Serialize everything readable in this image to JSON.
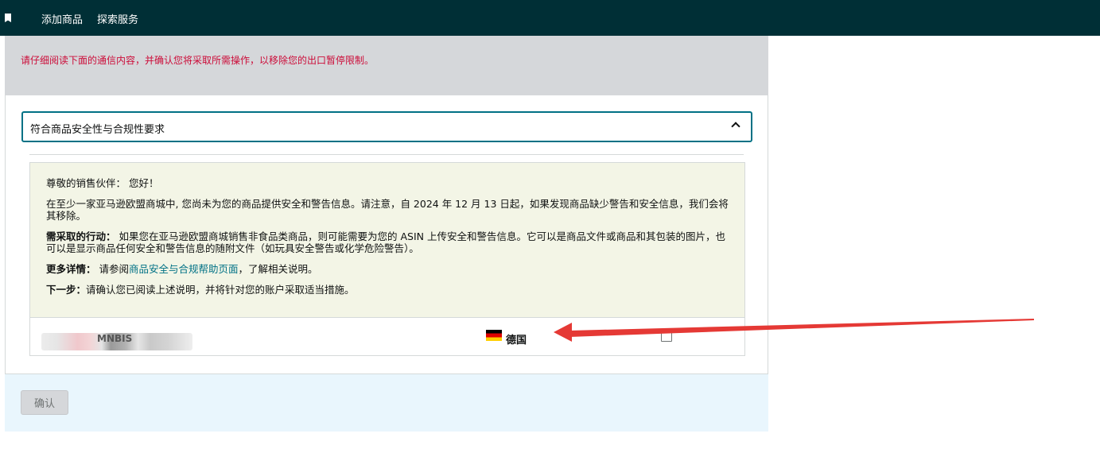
{
  "nav": {
    "add_product": "添加商品",
    "explore_services": "探索服务"
  },
  "notice": {
    "text": "请仔细阅读下面的通信内容，并确认您将采取所需操作，以移除您的出口暂停限制。"
  },
  "accordion": {
    "title": "符合商品安全性与合规性要求"
  },
  "message": {
    "greeting": "尊敬的销售伙伴： 您好！",
    "intro": "在至少一家亚马逊欧盟商城中, 您尚未为您的商品提供安全和警告信息。请注意，自 2024 年 12 月 13 日起，如果发现商品缺少警告和安全信息，我们会将其移除。",
    "action_label": "需采取的行动：",
    "action_text": " 如果您在亚马逊欧盟商城销售非食品类商品，则可能需要为您的 ASIN 上传安全和警告信息。它可以是商品文件或商品和其包装的图片，也可以是显示商品任何安全和警告信息的随附文件（如玩具安全警告或化学危险警告）。",
    "details_label": "更多详情：",
    "details_prefix": " 请参阅",
    "details_link": "商品安全与合规帮助页面",
    "details_suffix": "，了解相关说明。",
    "next_label": "下一步：",
    "next_text": "请确认您已阅读上述说明，并将针对您的账户采取适当措施。"
  },
  "row": {
    "sku_fragment": "MNBIS",
    "country": "德国",
    "checkbox_checked": false
  },
  "footer": {
    "confirm_label": "确认"
  },
  "colors": {
    "topbar": "#002f36",
    "notice_text": "#cc0c39",
    "accent": "#007185",
    "message_bg": "#f3f5e6",
    "footer_bg": "#e9f6fd",
    "annotation_arrow": "#e53935"
  }
}
